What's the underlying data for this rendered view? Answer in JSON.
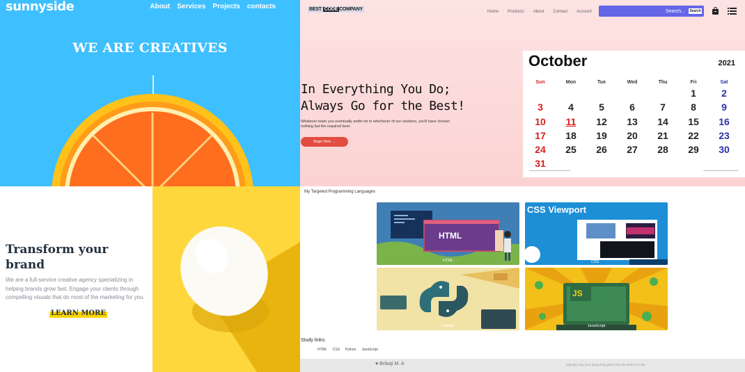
{
  "sunnyside": {
    "logo": "sunnyside",
    "nav": [
      "About",
      "Services",
      "Projects",
      "contacts"
    ],
    "headline": "WE ARE CREATIVES",
    "brand_color": "#3ebfff"
  },
  "transform": {
    "title": "Transform your brand",
    "body": "We are a full-service creative agency specializing in helping brands grow fast. Engage your clients through compelling visuals that do most of the marketing for you.",
    "cta": "LEARN MORE",
    "accent_color": "#fad400"
  },
  "bestcode": {
    "logo_left": "BEST",
    "logo_mid": "CODE",
    "logo_right": "COMPANY",
    "nav": [
      "Home",
      "Products",
      "About",
      "Contact",
      "Account"
    ],
    "search_placeholder": "Search...",
    "search_button": "Search",
    "heading_line1": "In Everything You Do;",
    "heading_line2": "Always Go for the Best!",
    "subtext": "Whatever team you eventually settle for in whichever of our sections, you'll have chosen nothing but the required best.",
    "cta": "Begin Here →",
    "search_color": "#6466e8",
    "cta_color": "#e34d41"
  },
  "calendar": {
    "month": "October",
    "year": "2021",
    "weekdays": [
      "Sun",
      "Mon",
      "Tue",
      "Wed",
      "Thu",
      "Fri",
      "Sat"
    ],
    "first_weekday_index": 5,
    "days_in_month": 31,
    "highlighted_day": 11
  },
  "languages": {
    "title": "My Targeted Programming Languages",
    "cards": [
      {
        "name": "HTML",
        "label": "HTML"
      },
      {
        "name": "CSS Viewport",
        "label": "CSS"
      },
      {
        "name": "Python",
        "label": "Python"
      },
      {
        "name": "JS",
        "label": "JavaScript"
      }
    ],
    "study_title": "Study links:",
    "study_links": [
      "HTML",
      "CSS",
      "Python",
      "JavaScript"
    ],
    "footer_author": "Bribaji M. A",
    "footer_note": "Majority may your dang thing place into the world of code"
  }
}
